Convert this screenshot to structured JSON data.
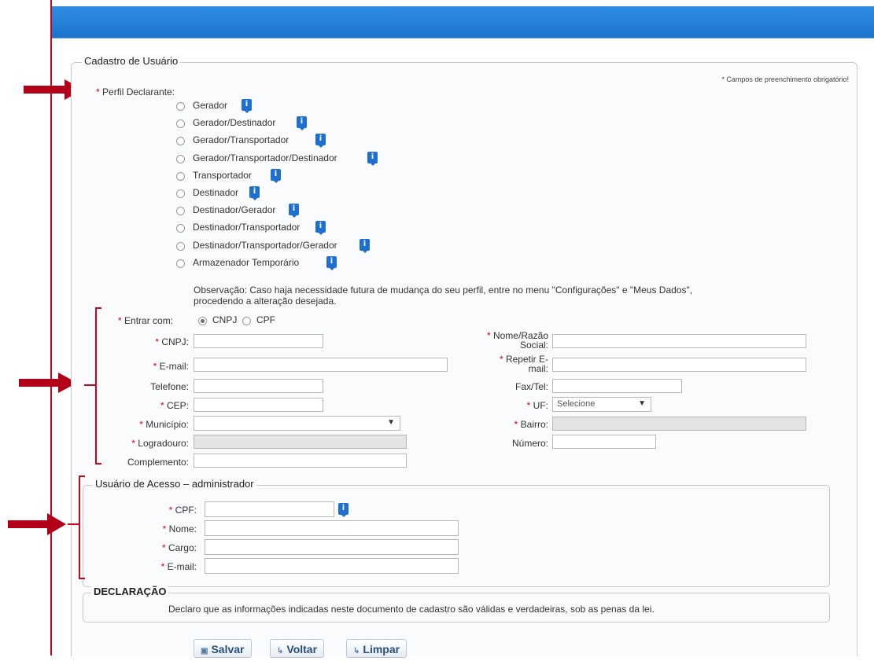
{
  "form": {
    "title": "Cadastro de Usuário",
    "required_note": "* Campos de preenchimento obrigatório!",
    "perfil_label": "Perfil Declarante:",
    "perfil_options": [
      "Gerador",
      "Gerador/Destinador",
      "Gerador/Transportador",
      "Gerador/Transportador/Destinador",
      "Transportador",
      "Destinador",
      "Destinador/Gerador",
      "Destinador/Transportador",
      "Destinador/Transportador/Gerador",
      "Armazenador Temporário"
    ],
    "observation_line1": "Observação: Caso haja necessidade futura de mudança do seu perfil, entre no menu \"Configurações\" e \"Meus Dados\",",
    "observation_line2": "procedendo a alteração desejada.",
    "entrar_com_label": "Entrar com:",
    "entrar_options": [
      "CNPJ",
      "CPF"
    ],
    "entrar_selected": "CNPJ",
    "cnpj_label": "CNPJ:",
    "email_label": "E-mail:",
    "telefone_label": "Telefone:",
    "cep_label": "CEP:",
    "municipio_label": "Município:",
    "logradouro_label": "Logradouro:",
    "complemento_label": "Complemento:",
    "nome_razao_label_1": "Nome/Razão",
    "nome_razao_label_2": "Social:",
    "repetir_email_label_1": "Repetir E-",
    "repetir_email_label_2": "mail:",
    "fax_label": "Fax/Tel:",
    "uf_label": "UF:",
    "uf_value": "Selecione",
    "bairro_label": "Bairro:",
    "numero_label": "Número:"
  },
  "admin": {
    "title": "Usuário de Acesso – administrador",
    "cpf_label": "CPF:",
    "nome_label": "Nome:",
    "cargo_label": "Cargo:",
    "email_label": "E-mail:"
  },
  "declaracao": {
    "title": "DECLARAÇÃO",
    "text": "Declaro que as informações indicadas neste documento de cadastro são válidas e verdadeiras, sob as penas da lei."
  },
  "buttons": {
    "salvar": "Salvar",
    "voltar": "Voltar",
    "limpar": "Limpar"
  },
  "icons": {
    "info": "info-icon",
    "arrow": "red-arrow-icon"
  },
  "colors": {
    "accent": "#1c74cd",
    "annotation_red": "#d0021b"
  }
}
